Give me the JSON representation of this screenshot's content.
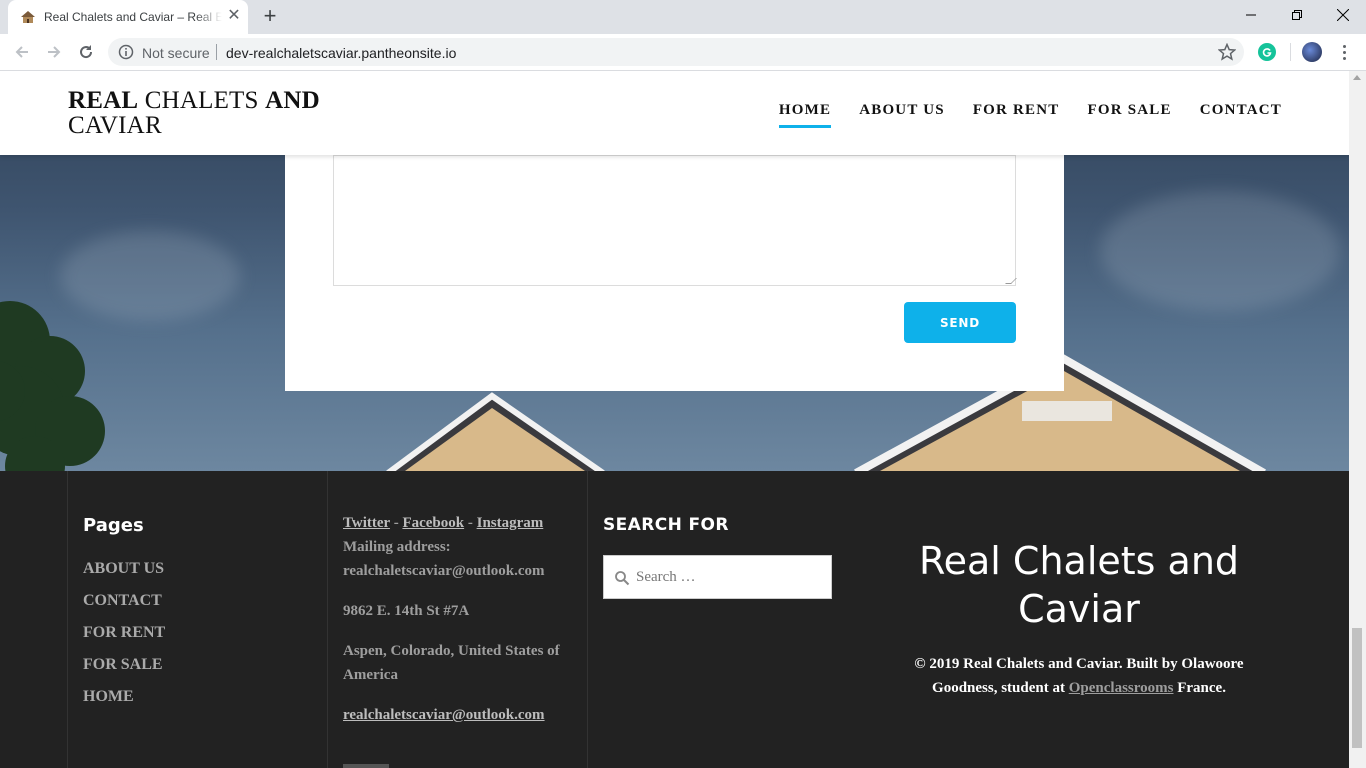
{
  "browser": {
    "tab_title": "Real Chalets and Caviar – Real Estate",
    "security_label": "Not secure",
    "url": "dev-realchaletscaviar.pantheonsite.io"
  },
  "header": {
    "title_part1": "REAL",
    "title_part2": " CHALETS ",
    "title_part3": "AND",
    "title_part4": "CAVIAR",
    "nav": [
      "HOME",
      "ABOUT US",
      "FOR RENT",
      "FOR SALE",
      "CONTACT"
    ],
    "active_nav": "HOME",
    "accent_color": "#0eb1ea"
  },
  "form": {
    "send_label": "SEND"
  },
  "footer": {
    "pages_heading": "Pages",
    "pages": [
      "ABOUT US",
      "CONTACT",
      "FOR RENT",
      "FOR SALE",
      "HOME"
    ],
    "social": [
      "Twitter",
      "Facebook",
      "Instagram"
    ],
    "social_sep": " - ",
    "mailing_label": "Mailing address:",
    "mailing_email": "realchaletscaviar@outlook.com",
    "address_line1": "9862 E. 14th St #7A",
    "address_line2": "Aspen, Colorado, United States of America",
    "email_link": "realchaletscaviar@outlook.com",
    "search_heading": "SEARCH FOR",
    "search_placeholder": "Search …",
    "brand_name": "Real Chalets and Caviar",
    "copyright_pre": "©  2019 Real Chalets and Caviar. Built by Olawoore Goodness, student at ",
    "copyright_link": "Openclassrooms",
    "copyright_post": " France."
  }
}
